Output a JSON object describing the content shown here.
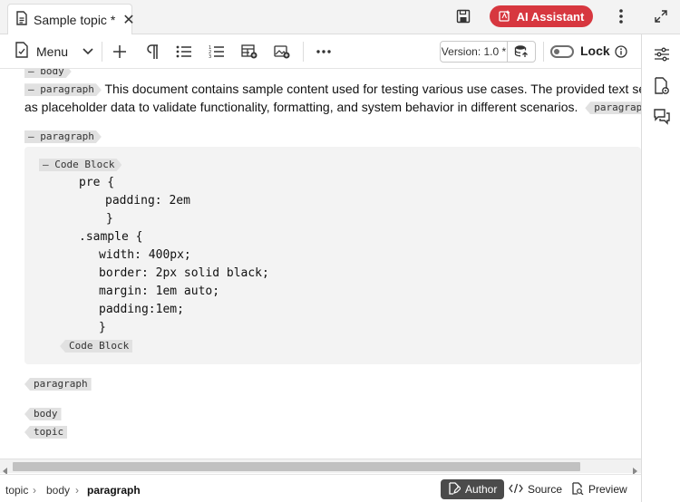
{
  "tab": {
    "title": "Sample topic *",
    "close": "✕"
  },
  "header": {
    "ai_label": "AI Assistant"
  },
  "toolbar": {
    "menu_label": "Menu",
    "version_label": "Version: 1.0 *",
    "lock_label": "Lock"
  },
  "editor": {
    "tags": {
      "body_top": "— body",
      "paragraph1": "— paragraph",
      "paragraph1_end": "paragraph",
      "paragraph2": "— paragraph",
      "codeblock_start": "— Code Block",
      "codeblock_end": "Code Block",
      "paragraph2_end": "paragraph",
      "body_end": "body",
      "topic_end": "topic"
    },
    "paragraph_line1": "This document contains sample content used for testing various use cases. The provided text serves",
    "paragraph_line2": "as placeholder data to validate functionality, formatting, and system behavior in different scenarios.",
    "code_lines": [
      "pre {",
      "padding: 2em",
      "}",
      ".sample {",
      "width: 400px;",
      "border: 2px solid black;",
      "margin: 1em auto;",
      "padding:1em;",
      "}"
    ]
  },
  "statusbar": {
    "breadcrumb": [
      "topic",
      "body",
      "paragraph"
    ],
    "modes": {
      "author": "Author",
      "source": "Source",
      "preview": "Preview"
    }
  },
  "colors": {
    "accent": "#d7373f",
    "tag_bg": "#e1e1e1",
    "code_bg": "#f3f3f3"
  }
}
